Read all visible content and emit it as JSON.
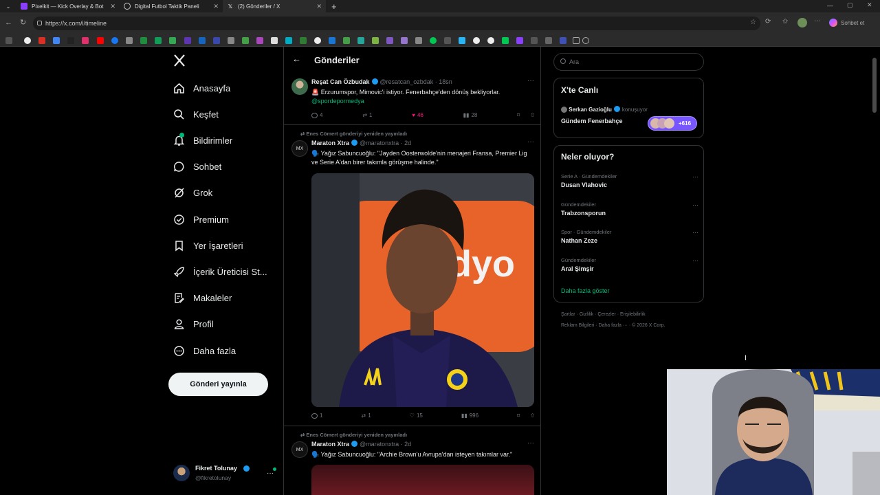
{
  "browser": {
    "tabs": [
      {
        "title": "Pixelkit — Kick Overlay & Bot"
      },
      {
        "title": "Digital Futbol Taktik Paneli"
      },
      {
        "title": "(2) Gönderiler / X"
      }
    ],
    "url": "https://x.com/i/timeline",
    "profile_button": "Sohbet et"
  },
  "nav": {
    "items": [
      {
        "label": "Anasayfa",
        "icon": "home-icon"
      },
      {
        "label": "Keşfet",
        "icon": "search-icon"
      },
      {
        "label": "Bildirimler",
        "icon": "bell-icon"
      },
      {
        "label": "Sohbet",
        "icon": "chat-icon"
      },
      {
        "label": "Grok",
        "icon": "grok-icon"
      },
      {
        "label": "Premium",
        "icon": "premium-icon"
      },
      {
        "label": "Yer İşaretleri",
        "icon": "bookmark-icon"
      },
      {
        "label": "İçerik Üreticisi St...",
        "icon": "rocket-icon"
      },
      {
        "label": "Makaleler",
        "icon": "article-icon"
      },
      {
        "label": "Profil",
        "icon": "profile-icon"
      },
      {
        "label": "Daha fazla",
        "icon": "more-circle-icon"
      }
    ],
    "post_button": "Gönderi yayınla",
    "account": {
      "name": "Fikret Tolunay",
      "handle": "@fikretolunay"
    }
  },
  "timeline": {
    "title": "Gönderiler",
    "tweets": [
      {
        "name": "Reşat Can Özbudak",
        "handle": "@resatcan_ozbdak",
        "time": "18sn",
        "text": "🚨 Erzurumspor, Mimovic'i istiyor. Fenerbahçe'den dönüş bekliyorlar.",
        "mention": "@spordepormedya",
        "replies": "4",
        "reposts": "1",
        "likes": "46",
        "views": "28"
      },
      {
        "retweeted_by": "Enes Cömert gönderiyi yeniden yayınladı",
        "name": "Maraton Xtra",
        "handle": "@maratonxtra",
        "time": "2d",
        "text": "🗣️ Yağız Sabuncuoğlu: \"Jayden Oosterwolde'nin menajeri Fransa, Premier Lig ve Serie A'dan birer takımla görüşme halinde.\"",
        "replies": "1",
        "reposts": "1",
        "likes": "15",
        "views": "996"
      },
      {
        "retweeted_by": "Enes Cömert gönderiyi yeniden yayınladı",
        "name": "Maraton Xtra",
        "handle": "@maratonxtra",
        "time": "2d",
        "text": "🗣️ Yağız Sabuncuoğlu: \"Archie Brown'u Avrupa'dan isteyen takımlar var.\""
      }
    ]
  },
  "sidebar": {
    "search_placeholder": "Ara",
    "live": {
      "title": "X'te Canlı",
      "host": "Serkan Gazioğlu",
      "status": "konuşuyor",
      "topic": "Gündem Fenerbahçe",
      "listeners": "+616"
    },
    "trends": {
      "title": "Neler oluyor?",
      "items": [
        {
          "meta": "Serie A · Gündemdekiler",
          "name": "Dusan Vlahovic"
        },
        {
          "meta": "Gündemdekiler",
          "name": "Trabzonsporun"
        },
        {
          "meta": "Spor · Gündemdekiler",
          "name": "Nathan Zeze"
        },
        {
          "meta": "Gündemdekiler",
          "name": "Aral Şimşir"
        }
      ],
      "show_more": "Daha fazla göster"
    },
    "footer_line1": [
      "Şartlar",
      "Gizlilik",
      "Çerezler",
      "Erişilebilirlik"
    ],
    "footer_line2": [
      "Reklam Bilgileri",
      "Daha fazla ···",
      "© 2026 X Corp."
    ]
  },
  "colors": {
    "accent": "#1d9bf0",
    "like": "#f91880",
    "green_link": "#00ba7c"
  }
}
